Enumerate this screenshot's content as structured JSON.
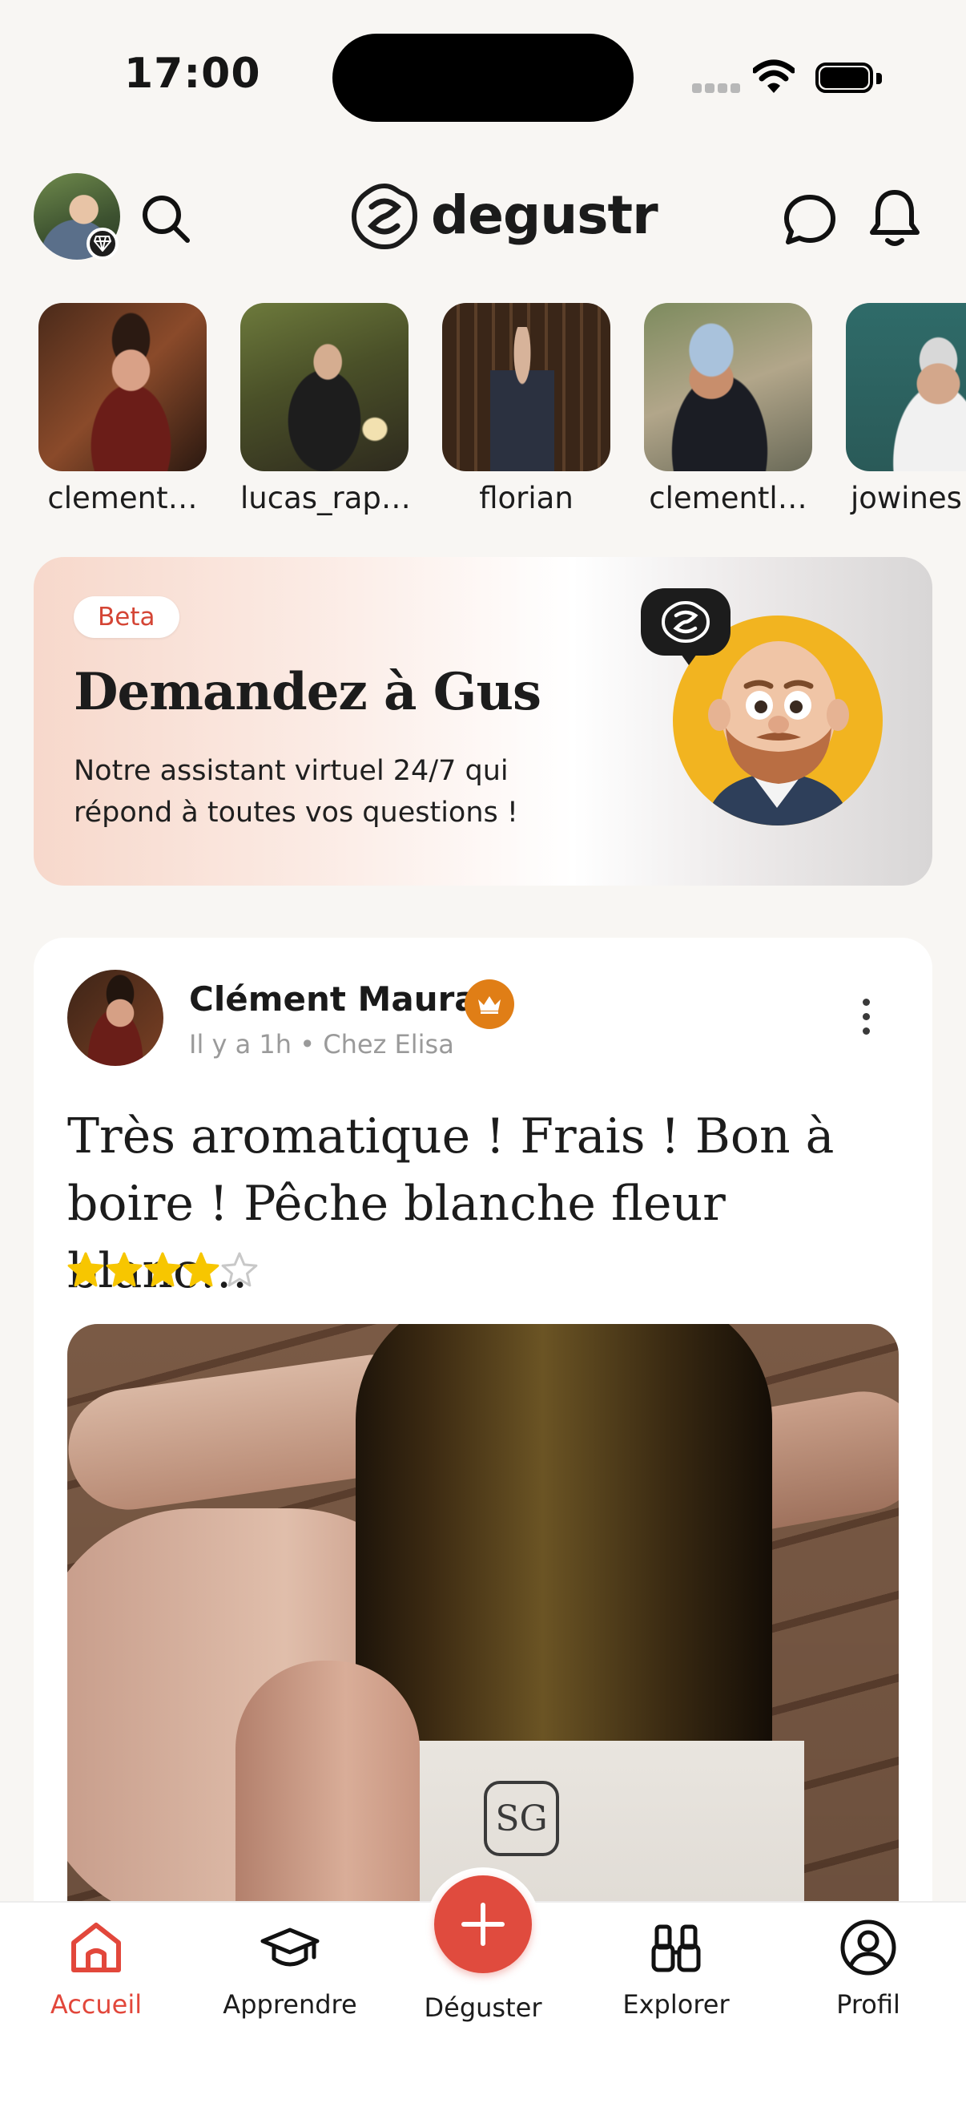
{
  "status_bar": {
    "time": "17:00"
  },
  "header": {
    "brand": "degustr"
  },
  "stories": [
    {
      "name": "clement…"
    },
    {
      "name": "lucas_rap…"
    },
    {
      "name": "florian"
    },
    {
      "name": "clementl…"
    },
    {
      "name": "jowines"
    }
  ],
  "gus_banner": {
    "badge": "Beta",
    "title": "Demandez à Gus",
    "description": "Notre assistant virtuel 24/7 qui répond à toutes vos questions !"
  },
  "post": {
    "author": "Clément Maura",
    "meta": "Il y a 1h • Chez Elisa",
    "text": "Très aromatique ! Frais ! Bon à boire ! Pêche blanche fleur blanc…",
    "rating": 4,
    "rating_max": 5,
    "label_logo": "SG"
  },
  "bottom_nav": [
    {
      "label": "Accueil",
      "icon": "home-icon",
      "active": true
    },
    {
      "label": "Apprendre",
      "icon": "graduation-cap-icon",
      "active": false
    },
    {
      "label": "Déguster",
      "icon": "plus-icon",
      "active": false
    },
    {
      "label": "Explorer",
      "icon": "binoculars-icon",
      "active": false
    },
    {
      "label": "Profil",
      "icon": "user-circle-icon",
      "active": false
    }
  ],
  "colors": {
    "accent": "#e04b3e",
    "crown": "#e07e16",
    "star": "#f7c600",
    "gus_bg": "#f2b420"
  }
}
